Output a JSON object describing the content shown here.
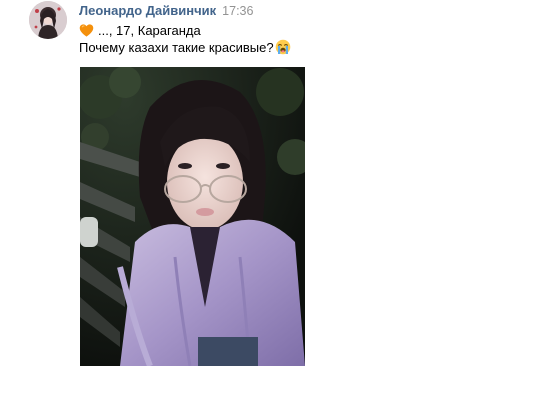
{
  "message": {
    "author": "Леонардо Дайвинчик",
    "time": "17:36",
    "line1_text": "..., 17, Караганда",
    "line2_text": "Почему казахи такие красивые?",
    "icons": {
      "heart": "orange-heart-icon",
      "emoji": "loudly-crying-face-icon"
    }
  },
  "colors": {
    "author": "#42648b",
    "time": "#939393",
    "text": "#000000",
    "heart": "#f4900c",
    "background": "#ffffff"
  }
}
